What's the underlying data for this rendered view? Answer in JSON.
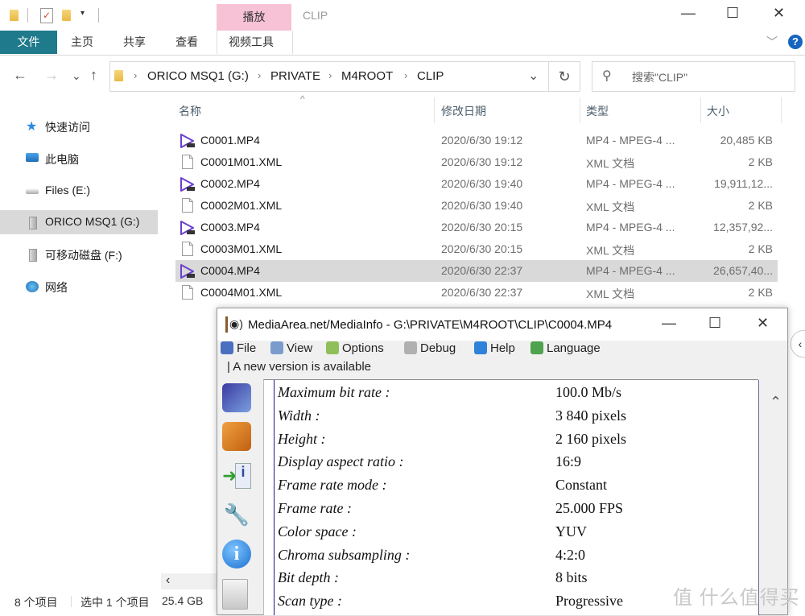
{
  "window": {
    "title": "CLIP",
    "context_tab": "播放",
    "minimize": "—",
    "maximize": "☐",
    "close": "✕"
  },
  "ribbon": {
    "tabs": [
      {
        "label": "文件",
        "active": true
      },
      {
        "label": "主页"
      },
      {
        "label": "共享"
      },
      {
        "label": "查看"
      },
      {
        "label": "视频工具"
      }
    ],
    "expand_icon": "﹀",
    "help_icon": "?"
  },
  "nav": {
    "back": "←",
    "forward": "→",
    "recent": "⌄",
    "up": "↑",
    "breadcrumb": [
      "ORICO MSQ1 (G:)",
      "PRIVATE",
      "M4ROOT",
      "CLIP"
    ],
    "separator": "›",
    "dropdown": "⌄",
    "refresh": "↻",
    "search_placeholder": "搜索\"CLIP\""
  },
  "sidebar": {
    "items": [
      {
        "label": "快速访问",
        "icon": "star-icon"
      },
      {
        "label": "此电脑",
        "icon": "computer-icon"
      },
      {
        "label": "Files (E:)",
        "icon": "drive-icon"
      },
      {
        "label": "ORICO MSQ1 (G:)",
        "icon": "usb-drive-icon",
        "selected": true
      },
      {
        "label": "可移动磁盘 (F:)",
        "icon": "usb-drive-icon"
      },
      {
        "label": "网络",
        "icon": "network-icon"
      }
    ]
  },
  "file_list": {
    "columns": [
      "名称",
      "修改日期",
      "类型",
      "大小"
    ],
    "sort_indicator": "^",
    "rows": [
      {
        "name": "C0001.MP4",
        "date": "2020/6/30 19:12",
        "type": "MP4 - MPEG-4 ...",
        "size": "20,485 KB",
        "kind": "mp4"
      },
      {
        "name": "C0001M01.XML",
        "date": "2020/6/30 19:12",
        "type": "XML 文档",
        "size": "2 KB",
        "kind": "xml"
      },
      {
        "name": "C0002.MP4",
        "date": "2020/6/30 19:40",
        "type": "MP4 - MPEG-4 ...",
        "size": "19,911,12...",
        "kind": "mp4"
      },
      {
        "name": "C0002M01.XML",
        "date": "2020/6/30 19:40",
        "type": "XML 文档",
        "size": "2 KB",
        "kind": "xml"
      },
      {
        "name": "C0003.MP4",
        "date": "2020/6/30 20:15",
        "type": "MP4 - MPEG-4 ...",
        "size": "12,357,92...",
        "kind": "mp4"
      },
      {
        "name": "C0003M01.XML",
        "date": "2020/6/30 20:15",
        "type": "XML 文档",
        "size": "2 KB",
        "kind": "xml"
      },
      {
        "name": "C0004.MP4",
        "date": "2020/6/30 22:37",
        "type": "MP4 - MPEG-4 ...",
        "size": "26,657,40...",
        "kind": "mp4",
        "selected": true
      },
      {
        "name": "C0004M01.XML",
        "date": "2020/6/30 22:37",
        "type": "XML 文档",
        "size": "2 KB",
        "kind": "xml"
      }
    ]
  },
  "status": {
    "item_count": "8 个项目",
    "selected": "选中 1 个项目",
    "selected_size": "25.4 GB",
    "scroll_left": "‹"
  },
  "mediainfo": {
    "title": "MediaArea.net/MediaInfo - G:\\PRIVATE\\M4ROOT\\CLIP\\C0004.MP4",
    "menu": [
      {
        "label": "File",
        "icon": "file-open-icon",
        "color": "#4a6fc0"
      },
      {
        "label": "View",
        "icon": "view-icon",
        "color": "#7a9ccc"
      },
      {
        "label": "Options",
        "icon": "options-icon",
        "color": "#8fbf5a"
      },
      {
        "label": "Debug",
        "icon": "debug-icon",
        "color": "#b0b0b0"
      },
      {
        "label": "Help",
        "icon": "help-icon",
        "color": "#2f82d9"
      },
      {
        "label": "Language",
        "icon": "globe-icon",
        "color": "#4fa34f"
      }
    ],
    "update_notice": "| A new version is available",
    "properties": [
      {
        "key": "Maximum bit rate :",
        "value": "100.0 Mb/s"
      },
      {
        "key": "Width :",
        "value": "3 840 pixels"
      },
      {
        "key": "Height :",
        "value": "2 160 pixels"
      },
      {
        "key": "Display aspect ratio :",
        "value": "16:9"
      },
      {
        "key": "Frame rate mode :",
        "value": "Constant"
      },
      {
        "key": "Frame rate :",
        "value": "25.000 FPS"
      },
      {
        "key": "Color space :",
        "value": "YUV"
      },
      {
        "key": "Chroma subsampling :",
        "value": "4:2:0"
      },
      {
        "key": "Bit depth :",
        "value": "8 bits"
      },
      {
        "key": "Scan type :",
        "value": "Progressive"
      }
    ],
    "scroll_up": "⌃",
    "minimize": "—",
    "maximize": "☐",
    "close": "✕"
  },
  "expand_handle": "‹",
  "watermark": "值 什么值得买"
}
